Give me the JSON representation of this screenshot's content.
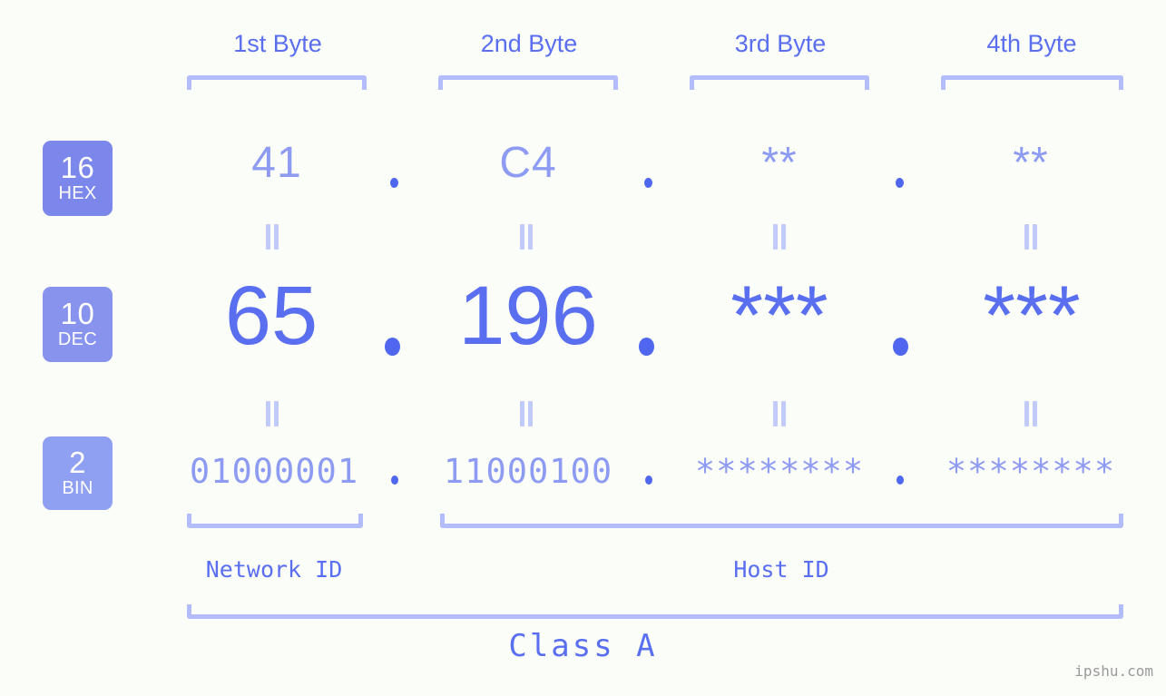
{
  "page": {
    "background_color": "#fbfdf8",
    "accent_color": "#5a6ef0",
    "muted_accent_color": "#8e9bf2",
    "bracket_color": "#b3bdfb",
    "watermark": "ipshu.com"
  },
  "byte_headers": [
    {
      "label": "1st Byte"
    },
    {
      "label": "2nd Byte"
    },
    {
      "label": "3rd Byte"
    },
    {
      "label": "4th Byte"
    }
  ],
  "bases": [
    {
      "num": "16",
      "system": "HEX",
      "color": "#7b87ea"
    },
    {
      "num": "10",
      "system": "DEC",
      "color": "#8893ee"
    },
    {
      "num": "2",
      "system": "BIN",
      "color": "#8fa0f2"
    }
  ],
  "rows": {
    "hex": {
      "values": [
        "41",
        "C4",
        "**",
        "**"
      ],
      "separator": "."
    },
    "dec": {
      "values": [
        "65",
        "196",
        "***",
        "***"
      ],
      "separator": "."
    },
    "bin": {
      "values": [
        "01000001",
        "11000100",
        "********",
        "********"
      ],
      "separator": "."
    }
  },
  "equals_connector": "=",
  "id_sections": [
    {
      "label": "Network ID"
    },
    {
      "label": "Host ID"
    }
  ],
  "class": {
    "label": "Class A"
  }
}
